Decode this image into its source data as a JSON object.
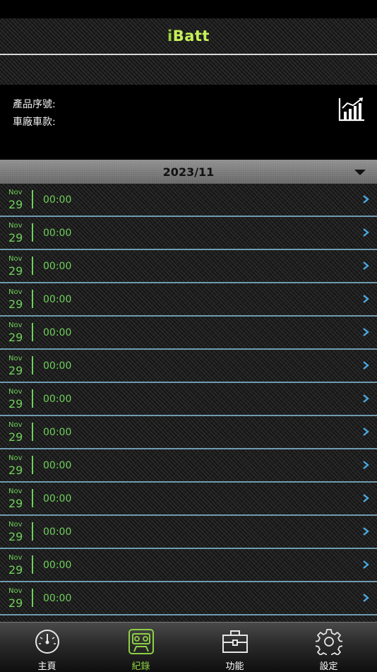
{
  "header": {
    "title_i": "i",
    "title_rest": "Batt"
  },
  "info": {
    "serial_label": "產品序號:",
    "vehicle_label": "車廠車款:"
  },
  "month_selector": {
    "label": "2023/11"
  },
  "records": [
    {
      "month": "Nov",
      "day": "29",
      "time": "00:00"
    },
    {
      "month": "Nov",
      "day": "29",
      "time": "00:00"
    },
    {
      "month": "Nov",
      "day": "29",
      "time": "00:00"
    },
    {
      "month": "Nov",
      "day": "29",
      "time": "00:00"
    },
    {
      "month": "Nov",
      "day": "29",
      "time": "00:00"
    },
    {
      "month": "Nov",
      "day": "29",
      "time": "00:00"
    },
    {
      "month": "Nov",
      "day": "29",
      "time": "00:00"
    },
    {
      "month": "Nov",
      "day": "29",
      "time": "00:00"
    },
    {
      "month": "Nov",
      "day": "29",
      "time": "00:00"
    },
    {
      "month": "Nov",
      "day": "29",
      "time": "00:00"
    },
    {
      "month": "Nov",
      "day": "29",
      "time": "00:00"
    },
    {
      "month": "Nov",
      "day": "29",
      "time": "00:00"
    },
    {
      "month": "Nov",
      "day": "29",
      "time": "00:00"
    }
  ],
  "tabs": [
    {
      "label": "主頁",
      "icon": "speedometer-icon"
    },
    {
      "label": "紀錄",
      "icon": "cassette-icon",
      "active": true
    },
    {
      "label": "功能",
      "icon": "toolbox-icon"
    },
    {
      "label": "設定",
      "icon": "gear-icon"
    }
  ],
  "colors": {
    "accent_green": "#6ed05a",
    "tab_active": "#8ed044",
    "chevron_blue": "#4aa8e0",
    "row_separator": "#6f9bb0"
  }
}
